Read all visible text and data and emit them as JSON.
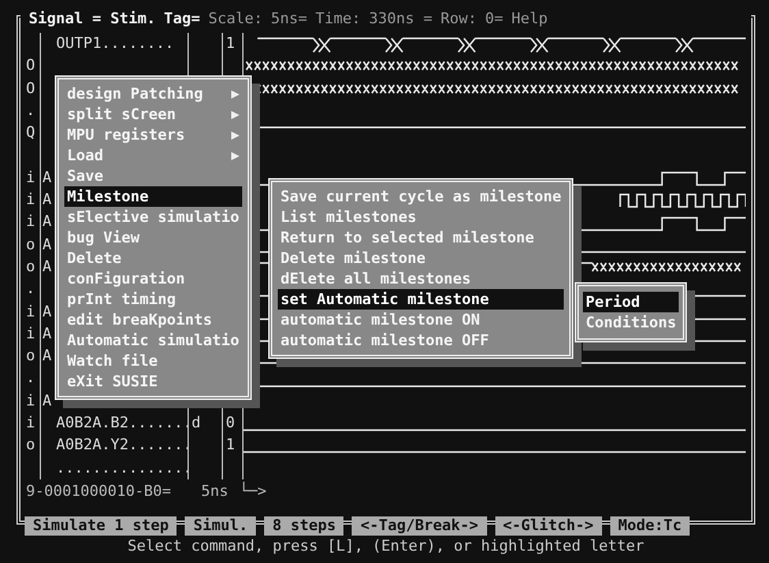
{
  "header": [
    "Signal = Stim.",
    "Tag=",
    "Scale:",
    "5ns=",
    "Time:",
    "330ns =",
    "Row:",
    "0=",
    "Help"
  ],
  "signals": [
    {
      "name": "OUTP1........",
      "value": "1",
      "kind": "xpulse"
    },
    {
      "dir": "O",
      "kind": "xfull"
    },
    {
      "dir": "O",
      "kind": "xfull"
    },
    {
      "dir": ".",
      "kind": "none"
    },
    {
      "dir": "Q",
      "kind": "high"
    },
    {
      "kind": "none"
    },
    {
      "dir": "i",
      "type": "A",
      "kind": "slow"
    },
    {
      "dir": "i",
      "type": "A",
      "kind": "clock"
    },
    {
      "dir": "i",
      "type": "A",
      "kind": "slow"
    },
    {
      "dir": "o",
      "type": "A",
      "kind": "low"
    },
    {
      "dir": "o",
      "type": "A",
      "kind": "bus"
    },
    {
      "dir": ".",
      "kind": "xend"
    },
    {
      "dir": "i",
      "type": "A",
      "kind": "low"
    },
    {
      "dir": "i",
      "type": "A",
      "kind": "low"
    },
    {
      "dir": "o",
      "type": "A",
      "kind": "low"
    },
    {
      "dir": ".",
      "kind": "low"
    },
    {
      "dir": "i",
      "type": "A",
      "kind": "none"
    },
    {
      "dir": "i",
      "name": "A0B2A.B2.......",
      "flag": "d",
      "value": "0",
      "kind": "low"
    },
    {
      "dir": "o",
      "name": "A0B2A.Y2.......",
      "value": "1",
      "kind": "low"
    },
    {
      "name": "...............",
      "kind": "none"
    }
  ],
  "cursor_line": {
    "address": "9-0001000010-B0=",
    "scale": "5ns",
    "arrow": "└─>"
  },
  "main_menu": [
    {
      "label": "design Patching",
      "submenu": true,
      "selected": false
    },
    {
      "label": "split sCreen",
      "submenu": true,
      "selected": false
    },
    {
      "label": "MPU registers",
      "submenu": true,
      "selected": false
    },
    {
      "label": "Load",
      "submenu": true,
      "selected": false
    },
    {
      "label": "Save",
      "submenu": false,
      "selected": false
    },
    {
      "label": "Milestone",
      "submenu": false,
      "selected": true
    },
    {
      "label": "sElective simulatio",
      "submenu": false,
      "selected": false
    },
    {
      "label": "bug View",
      "submenu": false,
      "selected": false
    },
    {
      "label": "Delete",
      "submenu": false,
      "selected": false
    },
    {
      "label": "conFiguration",
      "submenu": false,
      "selected": false
    },
    {
      "label": "prInt timing",
      "submenu": false,
      "selected": false
    },
    {
      "label": "edit breaKpoints",
      "submenu": false,
      "selected": false
    },
    {
      "label": "Automatic simulatio",
      "submenu": false,
      "selected": false
    },
    {
      "label": "Watch file",
      "submenu": false,
      "selected": false
    },
    {
      "label": "eXit SUSIE",
      "submenu": false,
      "selected": false
    }
  ],
  "milestone_menu": [
    {
      "label": "Save current cycle as milestone",
      "selected": false
    },
    {
      "label": "List milestones",
      "selected": false
    },
    {
      "label": "Return to selected milestone",
      "selected": false
    },
    {
      "label": "Delete milestone",
      "selected": false
    },
    {
      "label": "dElete all milestones",
      "selected": false
    },
    {
      "label": "set Automatic milestone",
      "selected": true
    },
    {
      "label": "automatic milestone ON",
      "selected": false
    },
    {
      "label": "automatic milestone OFF",
      "selected": false
    }
  ],
  "automatic_menu": [
    {
      "label": "Period",
      "selected": true
    },
    {
      "label": "Conditions",
      "selected": false
    }
  ],
  "function_keys": [
    "Simulate 1 step",
    "Simul.",
    "8 steps",
    "<-Tag/Break->",
    "<-Glitch->",
    "Mode:Tc"
  ],
  "hint": "Select command, press [L], (Enter), or highlighted letter"
}
